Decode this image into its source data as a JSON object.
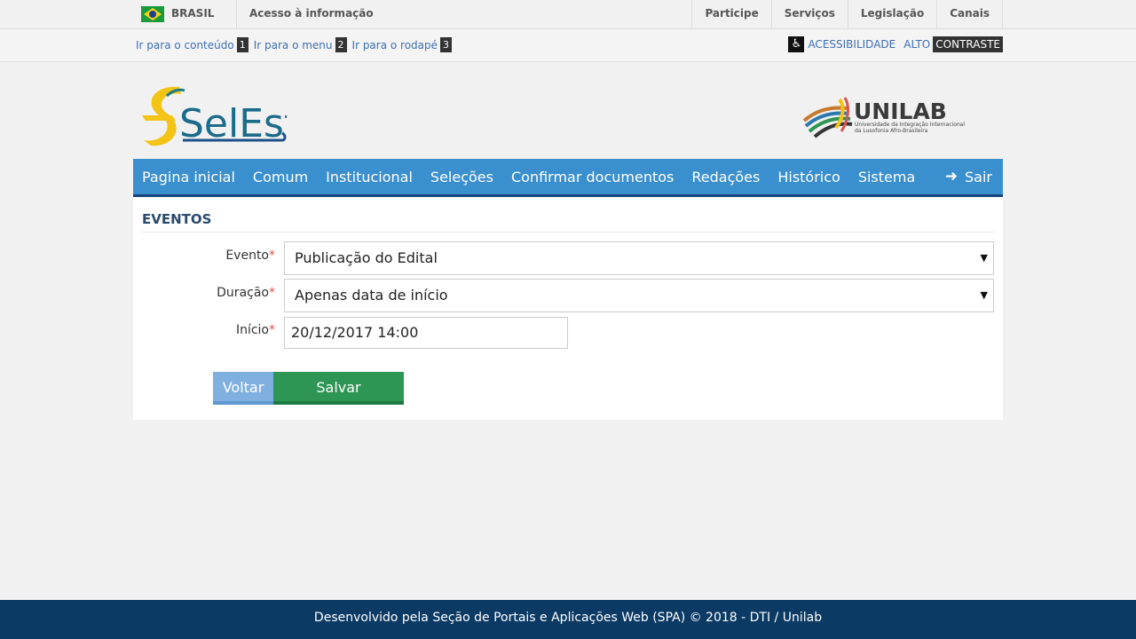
{
  "gov_bar": {
    "brasil": "BRASIL",
    "acesso": "Acesso à informação",
    "links": [
      "Participe",
      "Serviços",
      "Legislação",
      "Canais"
    ]
  },
  "accessibility": {
    "skip_links": [
      {
        "label": "Ir para o conteúdo",
        "key": "1"
      },
      {
        "label": "Ir para o menu",
        "key": "2"
      },
      {
        "label": "Ir para o rodapé",
        "key": "3"
      }
    ],
    "acessibilidade": "ACESSIBILIDADE",
    "alto": "ALTO",
    "contraste": "CONTRASTE"
  },
  "logos": {
    "selest": "SelEst",
    "unilab": "UNILAB",
    "unilab_sub1": "Universidade da Integração Internacional",
    "unilab_sub2": "da Lusofonia Afro-Brasileira"
  },
  "nav": {
    "items": [
      "Pagina inicial",
      "Comum",
      "Institucional",
      "Seleções",
      "Confirmar documentos",
      "Redações",
      "Histórico",
      "Sistema"
    ],
    "sair": "Sair"
  },
  "form": {
    "title": "EVENTOS",
    "evento_label": "Evento",
    "evento_value": "Publicação do Edital",
    "duracao_label": "Duração",
    "duracao_value": "Apenas data de início",
    "inicio_label": "Início",
    "inicio_value": "20/12/2017 14:00",
    "required_mark": "*",
    "voltar": "Voltar",
    "salvar": "Salvar"
  },
  "footer": {
    "text": "Desenvolvido pela Seção de Portais e Aplicações Web (SPA) © 2018 - DTI / Unilab"
  },
  "colors": {
    "nav_bg": "#3a8fcf",
    "nav_border": "#16457a",
    "salvar": "#2e9654",
    "voltar": "#7fb0e0",
    "footer_bg": "#0b3a64",
    "link": "#3d6fb3"
  }
}
